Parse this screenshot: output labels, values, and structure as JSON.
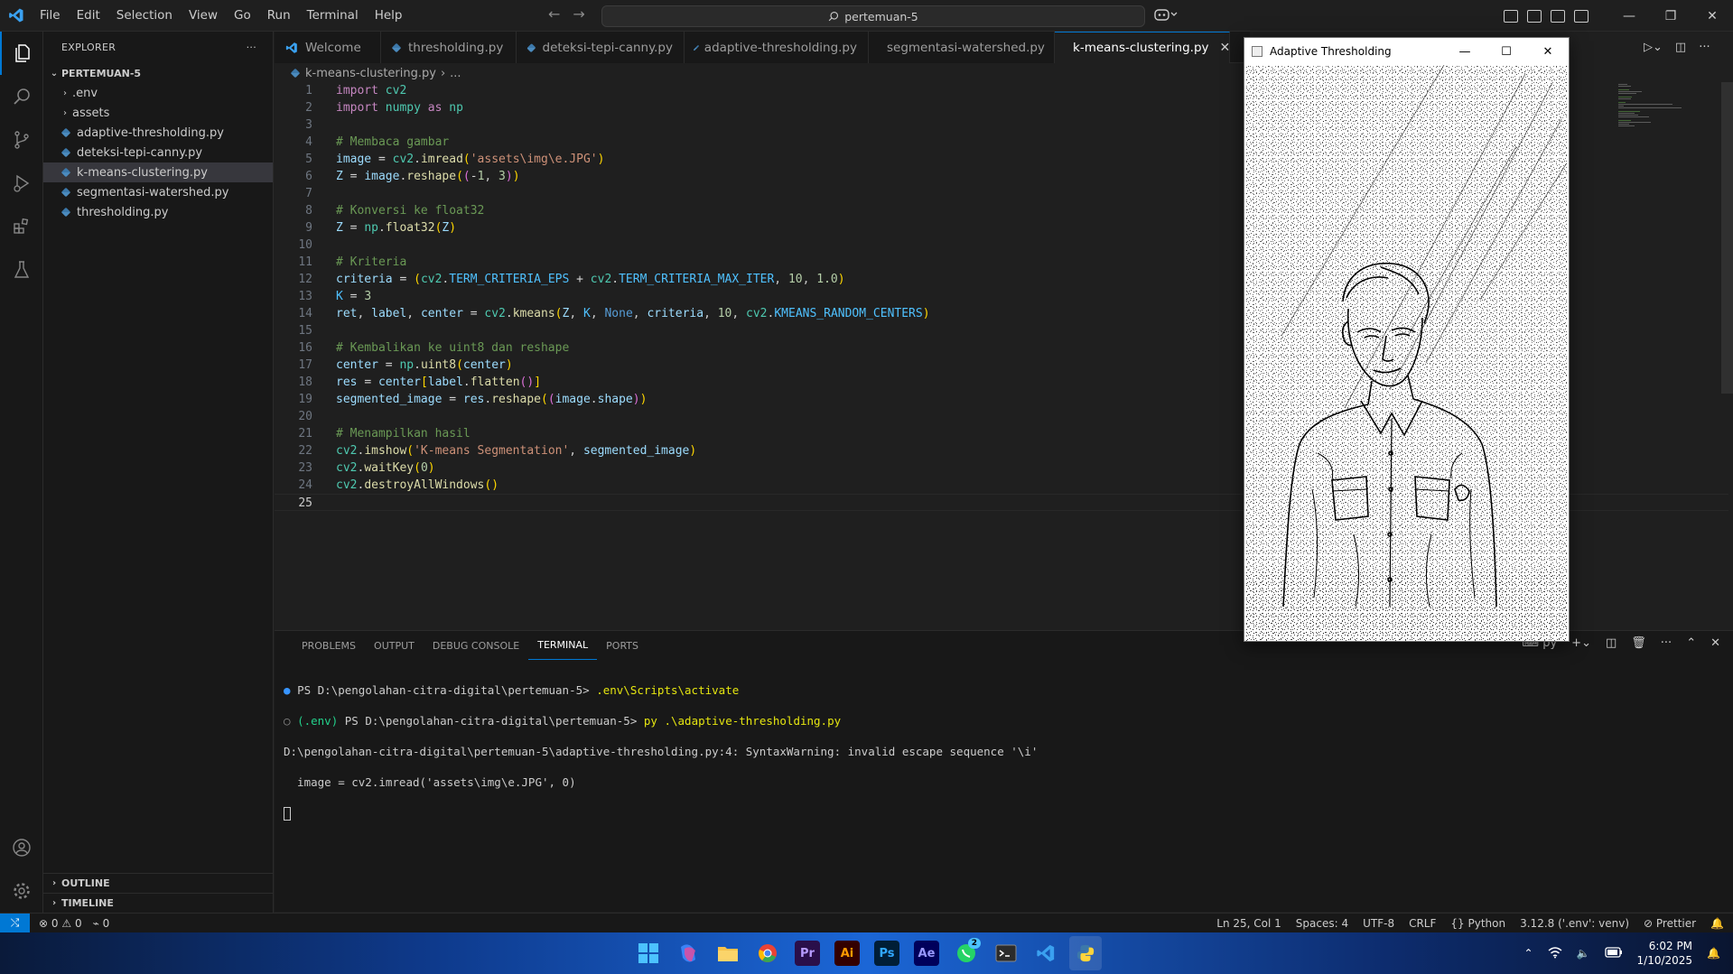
{
  "titlebar": {
    "menu": [
      "File",
      "Edit",
      "Selection",
      "View",
      "Go",
      "Run",
      "Terminal",
      "Help"
    ],
    "search_text": "pertemuan-5"
  },
  "sidebar": {
    "header": "EXPLORER",
    "folder": "PERTEMUAN-5",
    "items": [
      {
        "label": ".env",
        "type": "folder"
      },
      {
        "label": "assets",
        "type": "folder"
      },
      {
        "label": "adaptive-thresholding.py",
        "type": "file"
      },
      {
        "label": "deteksi-tepi-canny.py",
        "type": "file"
      },
      {
        "label": "k-means-clustering.py",
        "type": "file",
        "selected": true
      },
      {
        "label": "segmentasi-watershed.py",
        "type": "file"
      },
      {
        "label": "thresholding.py",
        "type": "file"
      }
    ],
    "outline": "OUTLINE",
    "timeline": "TIMELINE"
  },
  "tabs": [
    {
      "label": "Welcome",
      "icon": "vscode-icon"
    },
    {
      "label": "thresholding.py",
      "icon": "python-icon"
    },
    {
      "label": "deteksi-tepi-canny.py",
      "icon": "python-icon"
    },
    {
      "label": "adaptive-thresholding.py",
      "icon": "python-icon"
    },
    {
      "label": "segmentasi-watershed.py",
      "icon": "python-icon"
    },
    {
      "label": "k-means-clustering.py",
      "icon": "python-icon",
      "active": true
    }
  ],
  "breadcrumb": {
    "file": "k-means-clustering.py",
    "rest": "..."
  },
  "editor": {
    "current_line": 25,
    "line_numbers": [
      "1",
      "2",
      "3",
      "4",
      "5",
      "6",
      "7",
      "8",
      "9",
      "10",
      "11",
      "12",
      "13",
      "14",
      "15",
      "16",
      "17",
      "18",
      "19",
      "20",
      "21",
      "22",
      "23",
      "24",
      "25"
    ]
  },
  "panel": {
    "tabs": [
      "PROBLEMS",
      "OUTPUT",
      "DEBUG CONSOLE",
      "TERMINAL",
      "PORTS"
    ],
    "active_tab": "TERMINAL",
    "terminal_shell": "py",
    "terminal": {
      "l1_prompt": "PS D:\\pengolahan-citra-digital\\pertemuan-5> ",
      "l1_cmd": ".env\\Scripts\\activate",
      "l2_env": "(.env) ",
      "l2_prompt": "PS D:\\pengolahan-citra-digital\\pertemuan-5> ",
      "l2_cmd": "py .\\adaptive-thresholding.py",
      "l3": "D:\\pengolahan-citra-digital\\pertemuan-5\\adaptive-thresholding.py:4: SyntaxWarning: invalid escape sequence '\\i'",
      "l4": "  image = cv2.imread('assets\\img\\e.JPG', 0)"
    }
  },
  "statusbar": {
    "errors": "0",
    "warnings": "0",
    "ports": "0",
    "position": "Ln 25, Col 1",
    "spaces": "Spaces: 4",
    "encoding": "UTF-8",
    "eol": "CRLF",
    "language": "Python",
    "interpreter": "3.12.8 ('.env': venv)",
    "formatter": "Prettier"
  },
  "cv_window": {
    "title": "Adaptive Thresholding"
  },
  "taskbar": {
    "icons": [
      "windows-start-icon",
      "copilot-icon",
      "file-explorer-icon",
      "chrome-icon",
      "premiere-icon",
      "illustrator-icon",
      "photoshop-icon",
      "after-effects-icon",
      "whatsapp-icon",
      "terminal-icon",
      "vscode-icon",
      "python-icon"
    ],
    "labels": {
      "premiere": "Pr",
      "illustrator": "Ai",
      "photoshop": "Ps",
      "after_effects": "Ae"
    },
    "whatsapp_badge": "2",
    "time": "6:02 PM",
    "date": "1/10/2025"
  },
  "colors": {
    "accent": "#0078d4",
    "keyword": "#c586c0",
    "comment": "#6a9955",
    "string": "#ce9178"
  }
}
